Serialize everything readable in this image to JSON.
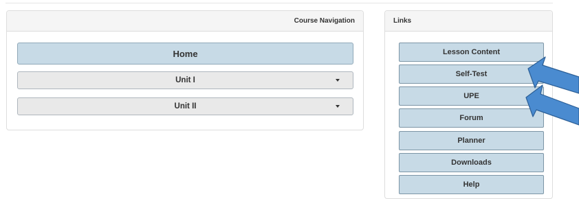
{
  "course_navigation": {
    "title": "Course Navigation",
    "home_label": "Home",
    "units": [
      {
        "label": "Unit I"
      },
      {
        "label": "Unit II"
      }
    ]
  },
  "links": {
    "title": "Links",
    "items": [
      {
        "label": "Lesson Content"
      },
      {
        "label": "Self-Test"
      },
      {
        "label": "UPE"
      },
      {
        "label": "Forum"
      },
      {
        "label": "Planner"
      },
      {
        "label": "Downloads"
      },
      {
        "label": "Help"
      }
    ]
  },
  "colors": {
    "button_blue": "#c7dae6",
    "annotation_arrow": "#4a8bd0"
  }
}
